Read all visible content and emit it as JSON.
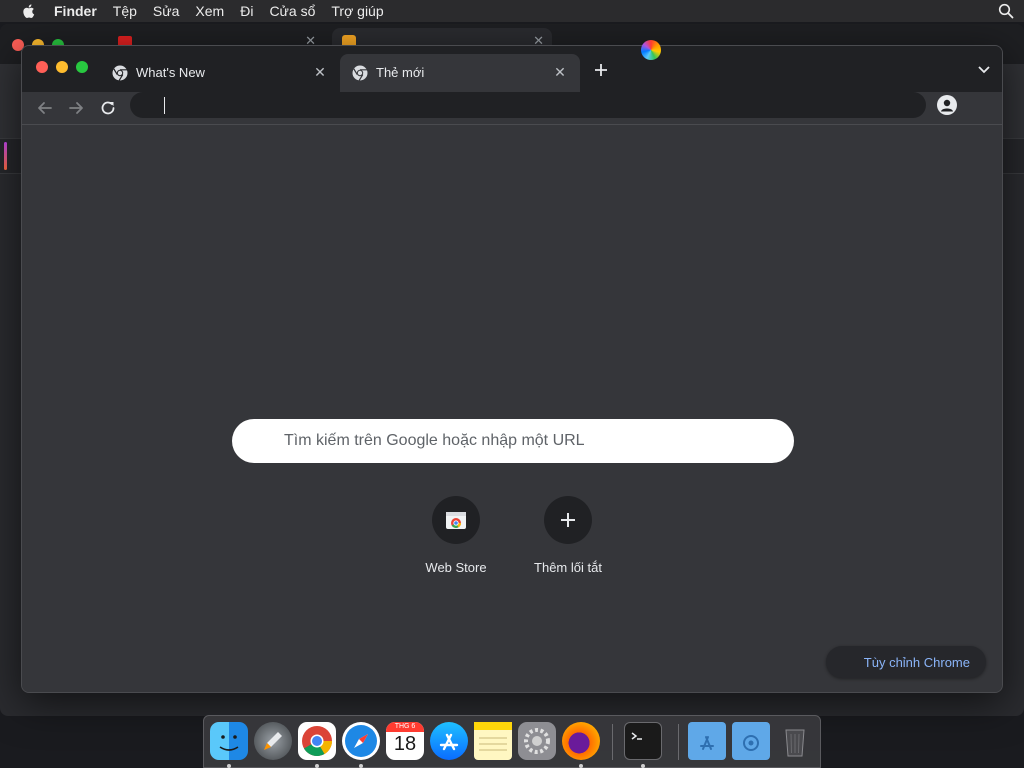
{
  "menubar": {
    "app": "Finder",
    "items": [
      "Tệp",
      "Sửa",
      "Xem",
      "Đi",
      "Cửa sổ",
      "Trợ giúp"
    ]
  },
  "chrome": {
    "tabs": [
      {
        "title": "What's New",
        "active": false
      },
      {
        "title": "Thẻ mới",
        "active": true
      }
    ],
    "omnibox_value": "",
    "ntp": {
      "search_placeholder": "Tìm kiếm trên Google hoặc nhập một URL",
      "shortcuts": [
        {
          "label": "Web Store",
          "icon": "web-store-icon"
        },
        {
          "label": "Thêm lối tắt",
          "icon": "plus-icon"
        }
      ],
      "customize_label": "Tùy chỉnh Chrome"
    }
  },
  "dock": {
    "apps": [
      "finder-icon",
      "launchpad-icon",
      "chrome-icon",
      "safari-icon",
      "calendar-icon",
      "app-store-icon",
      "notes-icon",
      "system-preferences-icon",
      "firefox-icon",
      "terminal-icon",
      "applications-folder-icon",
      "downloads-folder-icon",
      "trash-icon"
    ],
    "calendar": {
      "weekday": "THG 6",
      "day": "18"
    }
  },
  "colors": {
    "chrome_frame": "#202124",
    "chrome_toolbar": "#35363a",
    "link_blue": "#8ab4f8"
  }
}
